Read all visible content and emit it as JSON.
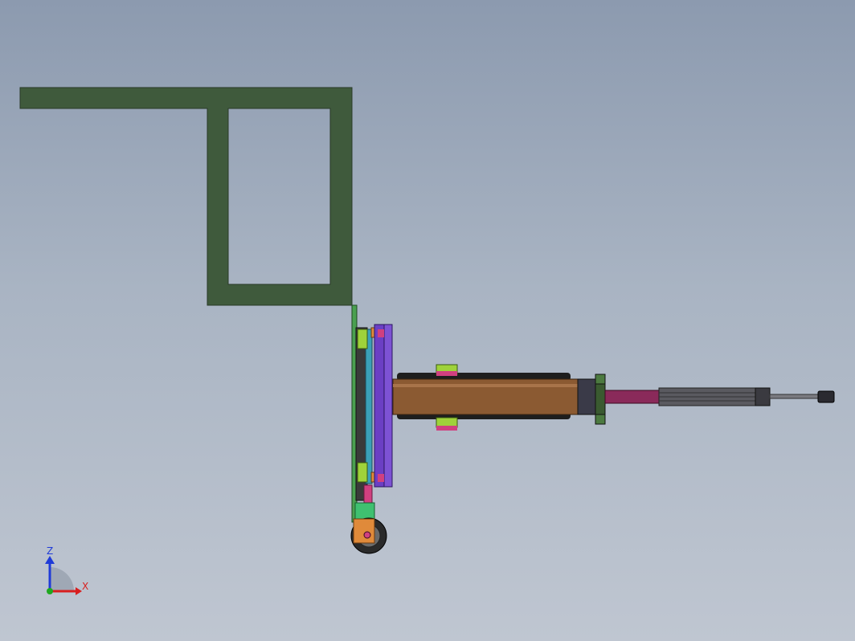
{
  "viewport": {
    "background_top": "#8c9aaf",
    "background_bottom": "#bfc6d1"
  },
  "triad": {
    "z_label": "Z",
    "x_label": "X",
    "z_color": "#1f3bd8",
    "x_color": "#d81f1f",
    "y_color": "#1fa81f"
  },
  "colors": {
    "frame_green": "#3f5a3c",
    "slide_purple": "#6b3fc4",
    "cylinder_brown": "#8b5a32",
    "rod_magenta": "#8a2a5a",
    "lime": "#9fd23a",
    "pink": "#d04080",
    "orange": "#e08a3a",
    "dark": "#2a2a2a"
  }
}
